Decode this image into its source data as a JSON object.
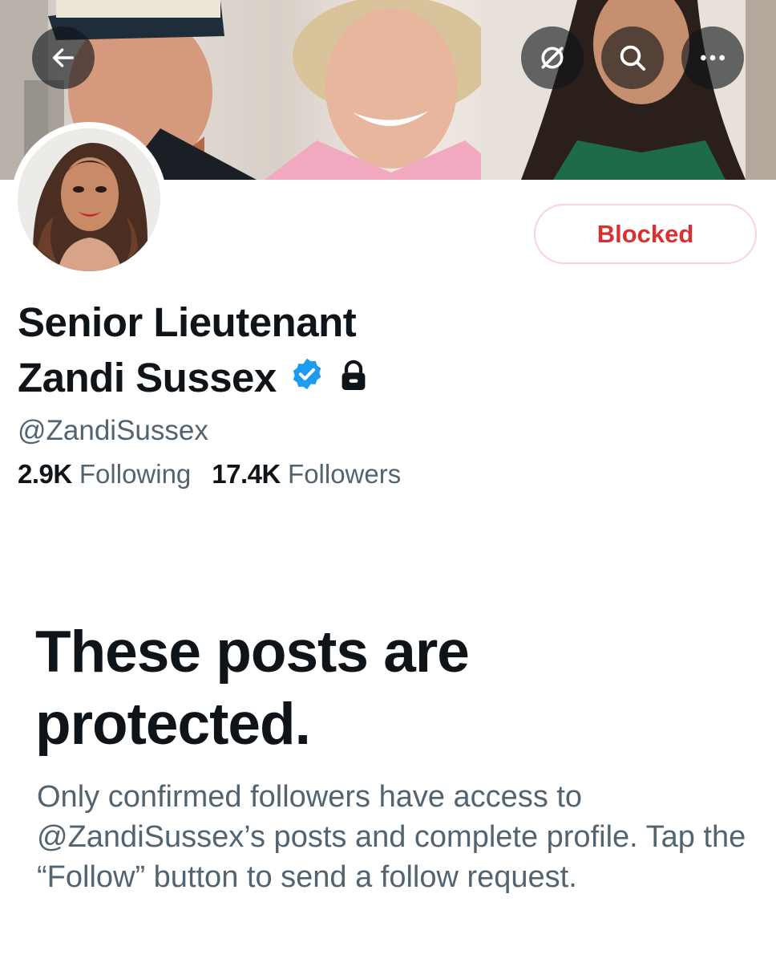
{
  "header": {
    "back_icon": "arrow-left-icon",
    "grok_icon": "grok-icon",
    "search_icon": "search-icon",
    "more_icon": "more-horizontal-icon"
  },
  "profile": {
    "name_line1": "Senior Lieutenant",
    "name_line2": "Zandi Sussex",
    "verified_icon": "verified-badge-icon",
    "protected_icon": "lock-icon",
    "handle": "@ZandiSussex",
    "following_count": "2.9K",
    "following_label": "Following",
    "followers_count": "17.4K",
    "followers_label": "Followers",
    "action_button": "Blocked"
  },
  "protected": {
    "title": "These posts are protected.",
    "description": "Only confirmed followers have access to @ZandiSussex’s posts and complete profile. Tap the “Follow” button to send a follow request."
  },
  "colors": {
    "text_primary": "#0f1419",
    "text_secondary": "#536471",
    "blocked_red": "#d9312f",
    "blocked_border": "#fbd3d6",
    "verified_blue": "#1d9bf0"
  }
}
